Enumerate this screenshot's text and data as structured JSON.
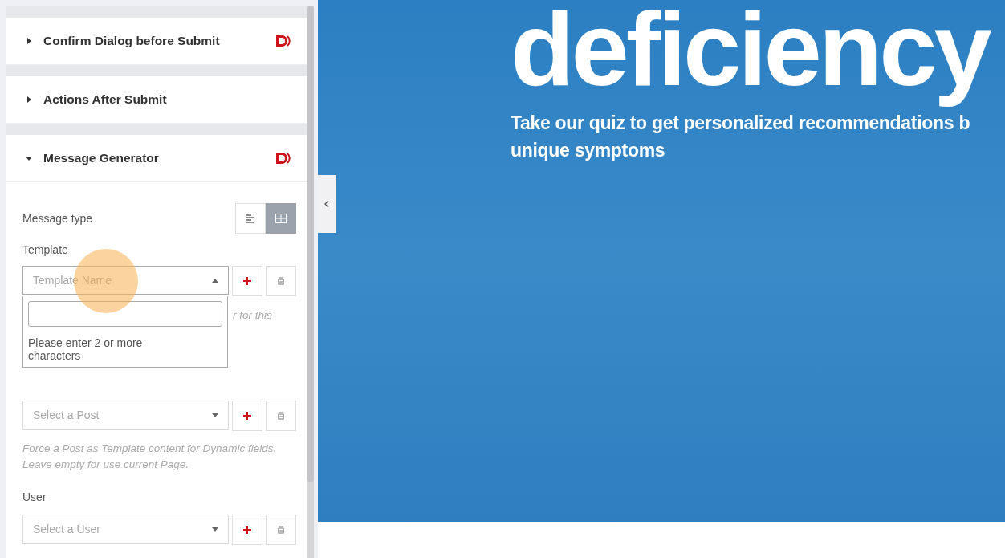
{
  "sections": [
    {
      "title": "Confirm Dialog before Submit",
      "expanded": false,
      "badge": true
    },
    {
      "title": "Actions After Submit",
      "expanded": false,
      "badge": false
    },
    {
      "title": "Message Generator",
      "expanded": true,
      "badge": true
    }
  ],
  "message_type": {
    "label": "Message type",
    "options": [
      {
        "kind": "text",
        "selected": false
      },
      {
        "kind": "grid",
        "selected": true
      }
    ]
  },
  "template": {
    "label": "Template",
    "placeholder": "Template Name",
    "open": true,
    "dropdown_message": "Please enter 2 or more characters",
    "hint": "r for this"
  },
  "post": {
    "placeholder": "Select a Post",
    "hint": "Force a Post as Template content for Dynamic fields. Leave empty for use current Page."
  },
  "user": {
    "label": "User",
    "placeholder": "Select a User"
  },
  "preview": {
    "heading": "deficiency",
    "subtitle_lines": [
      "Take our quiz to get personalized recommendations b",
      "unique symptoms"
    ]
  }
}
